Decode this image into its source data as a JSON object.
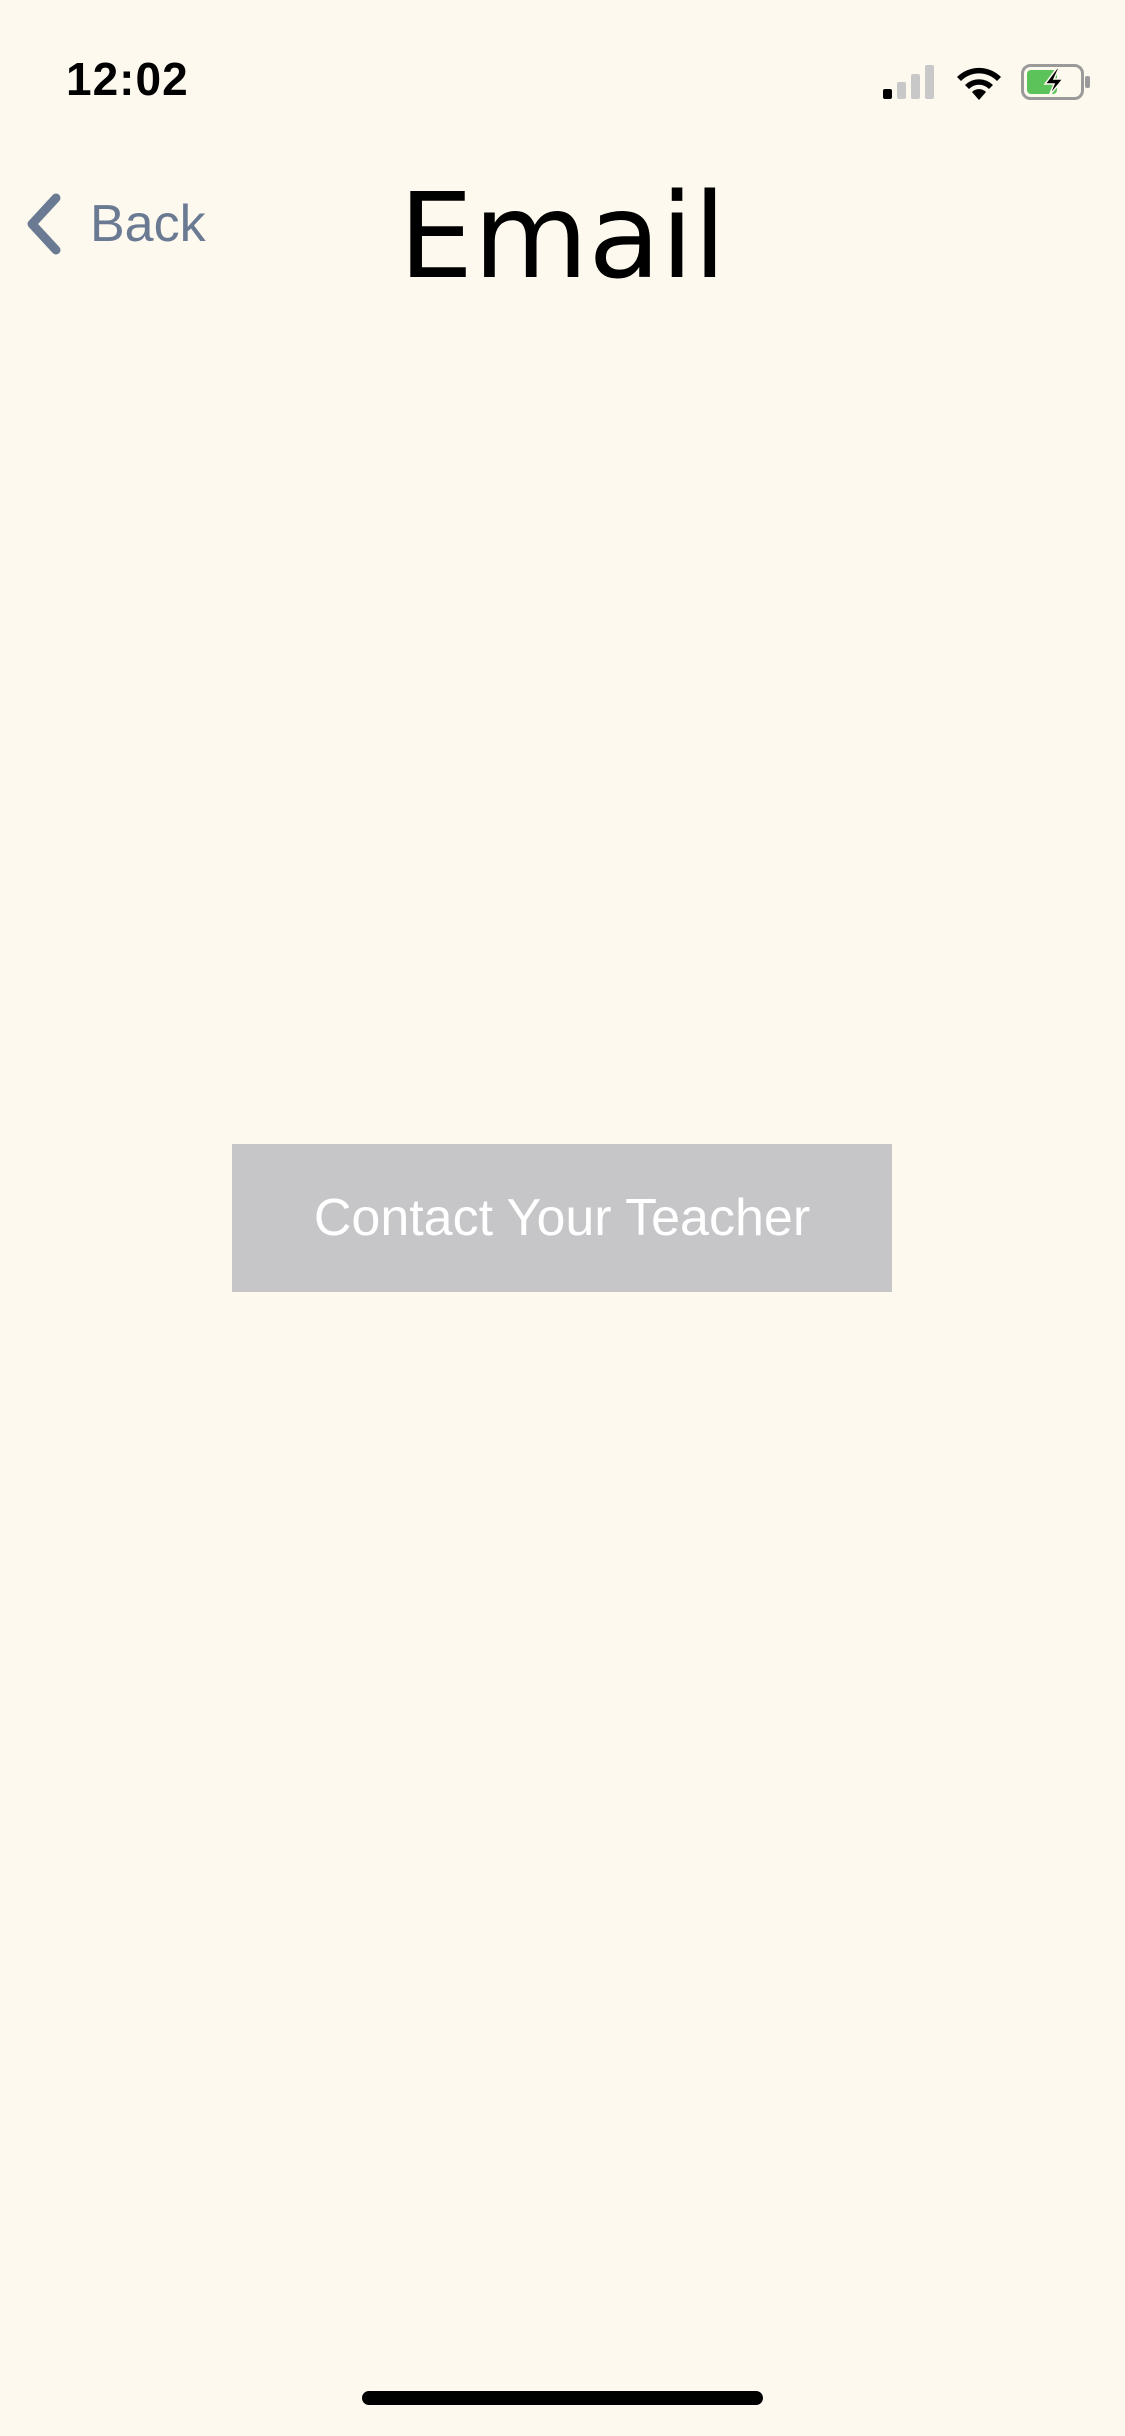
{
  "status_bar": {
    "time": "12:02",
    "signal_icon": "cellular-signal-icon",
    "wifi_icon": "wifi-icon",
    "battery_icon": "battery-charging-icon",
    "battery_color": "#5bc35a"
  },
  "nav": {
    "back_label": "Back",
    "back_icon": "chevron-left-icon",
    "title": "Email",
    "accent_color": "#6b7a93"
  },
  "main": {
    "contact_button_label": "Contact Your Teacher",
    "contact_button_color": "#c6c6c8"
  },
  "theme": {
    "background": "#fdf9ef"
  }
}
